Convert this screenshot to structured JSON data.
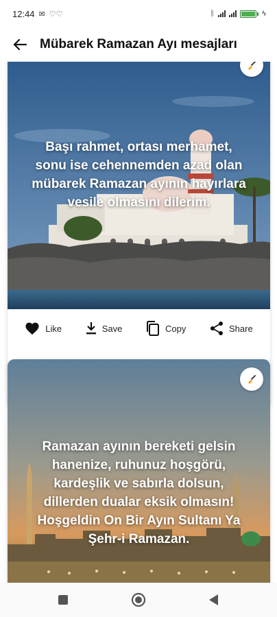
{
  "status_bar": {
    "time": "12:44",
    "battery_level": 1.0,
    "battery_color": "#4caf50"
  },
  "app_bar": {
    "title": "Mübarek Ramazan Ayı mesajları",
    "back_icon": "arrow-back-icon"
  },
  "cards": [
    {
      "quote": "Başı rahmet, ortası merhamet, sonu ise cehennemden azad olan mübarek Ramazan ayının hayırlara vesile olmasını dilerim.",
      "badge_icon": "edit-brush-icon"
    },
    {
      "quote": "Ramazan ayının bereketi gelsin hanenize, ruhunuz hoşgörü, kardeşlik ve sabırla dolsun, dillerden dualar eksik olmasın! Hoşgeldin On Bir Ayın Sultanı Ya Şehr-i Ramazan.",
      "badge_icon": "edit-brush-icon"
    }
  ],
  "actions": {
    "like": "Like",
    "save": "Save",
    "copy": "Copy",
    "share": "Share"
  },
  "nav_bar": {
    "recents_icon": "square-icon",
    "home_icon": "circle-icon",
    "back_icon": "triangle-back-icon"
  },
  "colors": {
    "sky_top": "#2c5a8c",
    "sky_bottom": "#6f93b8",
    "sunset_top": "#5f7f99",
    "sunset_bottom": "#d79a5e",
    "badge_accent": "#f2a21b"
  }
}
